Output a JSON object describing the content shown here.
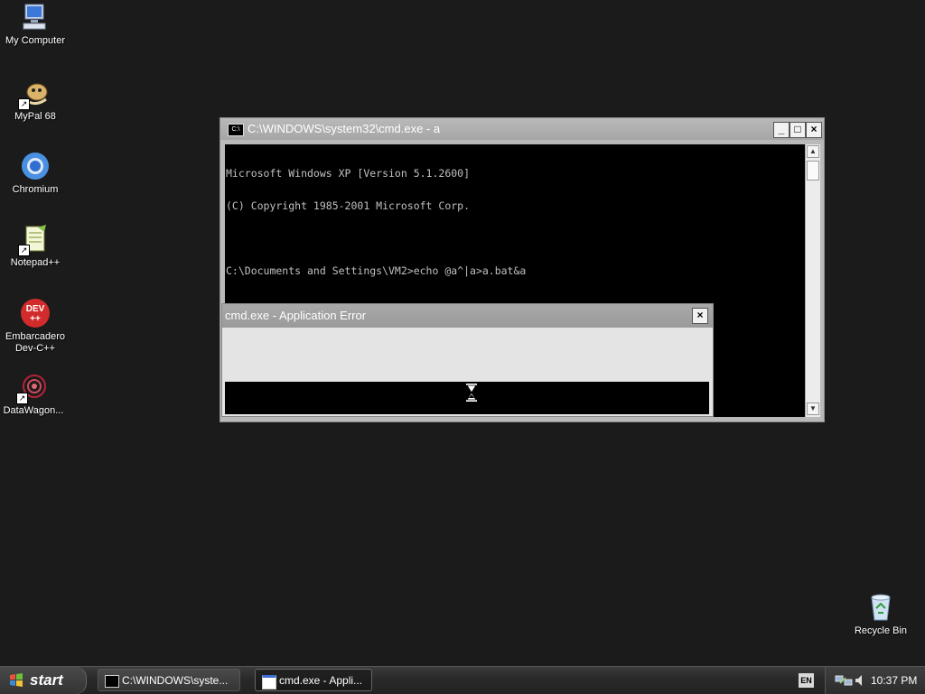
{
  "desktop": {
    "icons": [
      {
        "label": "My Computer"
      },
      {
        "label": "MyPal 68"
      },
      {
        "label": "Chromium"
      },
      {
        "label": "Notepad++"
      },
      {
        "label": "Embarcadero Dev-C++"
      },
      {
        "label": "DataWagon..."
      }
    ],
    "recycle_bin": {
      "label": "Recycle Bin"
    }
  },
  "cmd_window": {
    "title": "C:\\WINDOWS\\system32\\cmd.exe - a",
    "lines": [
      "Microsoft Windows XP [Version 5.1.2600]",
      "(C) Copyright 1985-2001 Microsoft Corp.",
      "",
      "C:\\Documents and Settings\\VM2>echo @a^|a>a.bat&a"
    ],
    "minimize": "_",
    "maximize": "□",
    "close": "×"
  },
  "error_dialog": {
    "title": "cmd.exe - Application Error",
    "close": "×"
  },
  "taskbar": {
    "start_label": "start",
    "tasks": [
      {
        "label": "C:\\WINDOWS\\syste..."
      },
      {
        "label": "cmd.exe - Appli..."
      }
    ],
    "language": "EN",
    "clock": "10:37 PM"
  },
  "colors": {
    "desktop_bg": "#1b1b1b",
    "console_bg": "#000000",
    "console_text": "#c0c0c0"
  }
}
